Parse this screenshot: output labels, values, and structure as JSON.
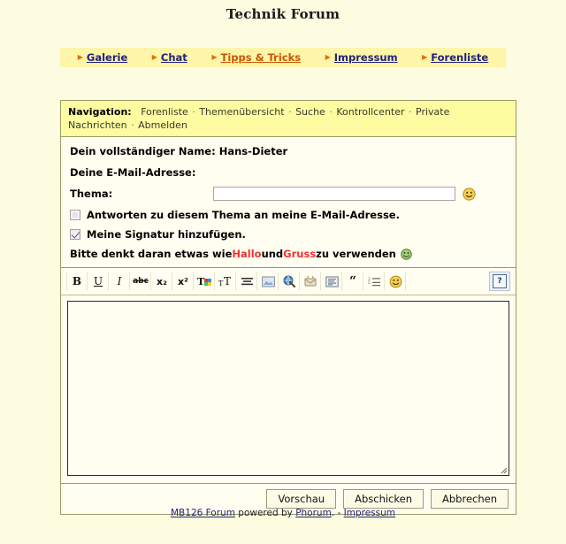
{
  "page": {
    "title": "Technik Forum"
  },
  "topmenu": {
    "items": [
      {
        "label": "Galerie",
        "style": "normal"
      },
      {
        "label": "Chat",
        "style": "normal"
      },
      {
        "label": "Tipps & Tricks",
        "style": "alt"
      },
      {
        "label": "Impressum",
        "style": "normal"
      },
      {
        "label": "Forenliste",
        "style": "normal"
      }
    ]
  },
  "navigation": {
    "label": "Navigation:",
    "links": [
      "Forenliste",
      "Themenübersicht",
      "Suche",
      "Kontrollcenter",
      "Private Nachrichten",
      "Abmelden"
    ],
    "separator": "·"
  },
  "form": {
    "name_label": "Dein vollständiger Name:",
    "name_value": "Hans-Dieter",
    "email_label": "Deine E-Mail-Adresse:",
    "thema_label": "Thema:",
    "thema_value": "",
    "thema_placeholder": "",
    "smiley_icon": "smiley-face-icon",
    "checkbox_reply": {
      "label": "Antworten zu diesem Thema an meine E-Mail-Adresse.",
      "checked": false
    },
    "checkbox_signature": {
      "label": "Meine Signatur hinzufügen.",
      "checked": true
    },
    "hint": {
      "part1": "Bitte denkt daran etwas wie ",
      "word1": "Hallo",
      "part2": " und ",
      "word2": "Gruss",
      "part3": " zu verwenden",
      "icon": "green-smiley-icon"
    },
    "body_value": "",
    "body_placeholder": ""
  },
  "toolbar": {
    "buttons": [
      {
        "name": "bold-icon",
        "glyph": "B"
      },
      {
        "name": "underline-icon",
        "glyph": "U"
      },
      {
        "name": "italic-icon",
        "glyph": "I"
      },
      {
        "name": "strikethrough-icon",
        "glyph": "abc"
      },
      {
        "name": "subscript-icon",
        "glyph": "x₂"
      },
      {
        "name": "superscript-icon",
        "glyph": "x²"
      },
      {
        "name": "text-color-icon",
        "glyph": "T"
      },
      {
        "name": "font-size-icon",
        "glyph": "T"
      },
      {
        "name": "align-icon",
        "glyph": "≡"
      },
      {
        "name": "image-icon",
        "glyph": "▨"
      },
      {
        "name": "link-icon",
        "glyph": "●"
      },
      {
        "name": "email-link-icon",
        "glyph": "✉"
      },
      {
        "name": "code-block-icon",
        "glyph": "▤"
      },
      {
        "name": "quote-icon",
        "glyph": "“"
      },
      {
        "name": "list-icon",
        "glyph": "≔"
      },
      {
        "name": "smiley-icon",
        "glyph": "☺"
      }
    ],
    "help_label": "?"
  },
  "actions": {
    "preview": "Vorschau",
    "submit": "Abschicken",
    "cancel": "Abbrechen"
  },
  "footer": {
    "forum_link": "MB126 Forum",
    "powered_text": " powered by ",
    "phorum_link": "Phorum",
    "mid_text": ". - ",
    "impressum_link": "Impressum"
  },
  "colors": {
    "page_background": "#fdfbe0",
    "menu_background": "#fdf5a9",
    "nav_background": "#fdfca0",
    "content_background": "#fffef0",
    "link": "#23237a",
    "link_alt": "#cc5500",
    "accent_red": "#ee3333",
    "border": "#9a9a6a"
  }
}
